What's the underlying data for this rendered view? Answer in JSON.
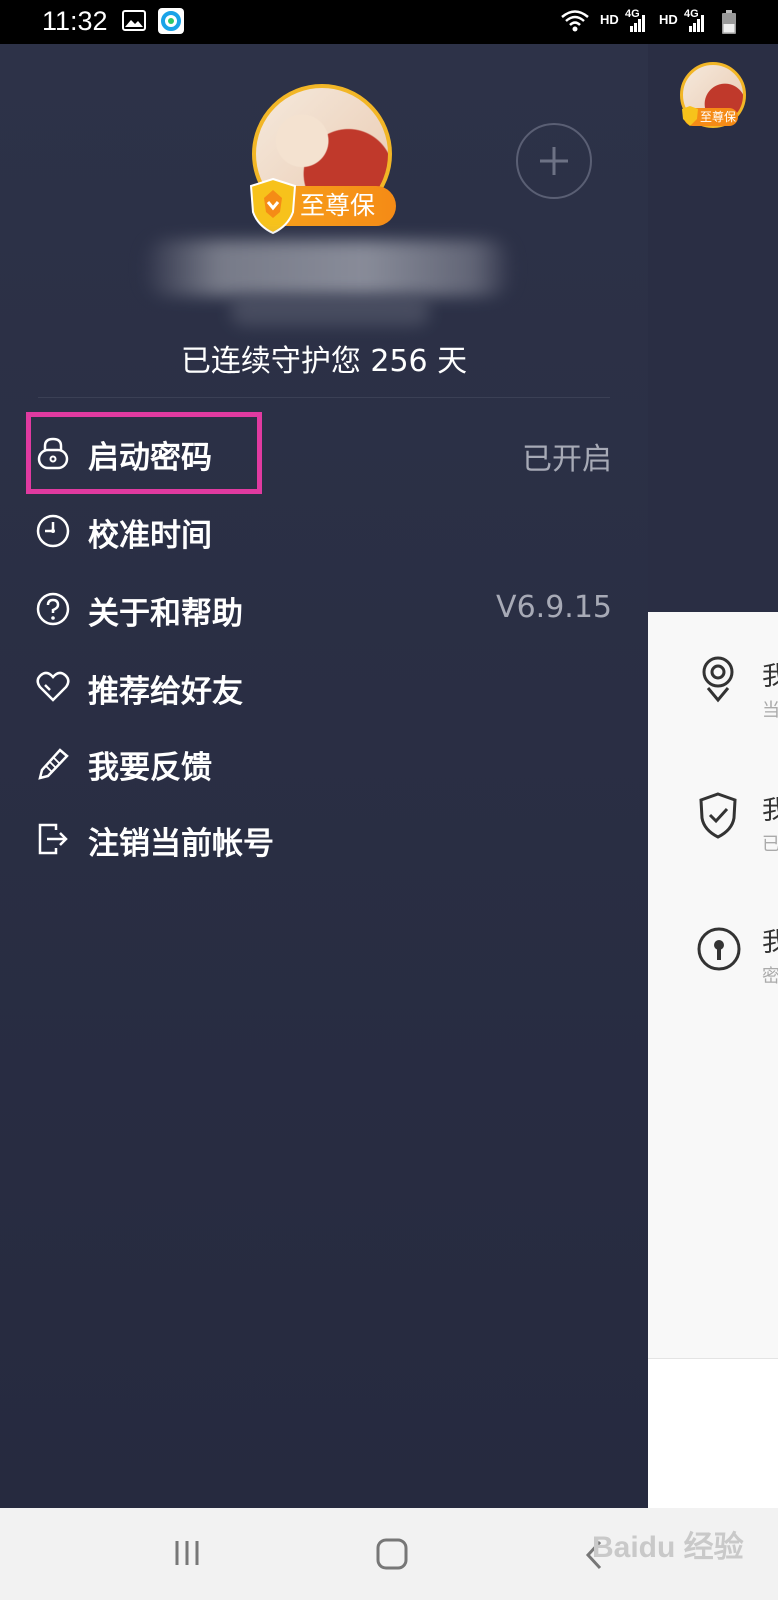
{
  "status_bar": {
    "time": "11:32",
    "net1": "HD",
    "net1_gen": "4G",
    "net2": "HD",
    "net2_gen": "4G"
  },
  "profile": {
    "badge_label": "至尊保",
    "protect_text": "已连续守护您 256 天"
  },
  "menu": {
    "items": [
      {
        "label": "启动密码",
        "value": "已开启",
        "icon": "lock-icon"
      },
      {
        "label": "校准时间",
        "value": "",
        "icon": "clock-icon"
      },
      {
        "label": "关于和帮助",
        "value": "V6.9.15",
        "icon": "help-icon"
      },
      {
        "label": "推荐给好友",
        "value": "",
        "icon": "heart-icon"
      },
      {
        "label": "我要反馈",
        "value": "",
        "icon": "pencil-icon"
      },
      {
        "label": "注销当前帐号",
        "value": "",
        "icon": "logout-icon"
      }
    ]
  },
  "right_panel": {
    "rows": [
      {
        "title": "我",
        "sub": "当",
        "icon": "location-icon"
      },
      {
        "title": "我",
        "sub": "已",
        "icon": "shield-check-icon"
      },
      {
        "title": "我",
        "sub": "密",
        "icon": "keyhole-icon"
      }
    ]
  },
  "watermark": "Baidu 经验",
  "colors": {
    "drawer_bg": "#282c40",
    "accent_gold": "#f2b626",
    "badge_orange": "#f58b16",
    "highlight": "#e03aa0"
  }
}
